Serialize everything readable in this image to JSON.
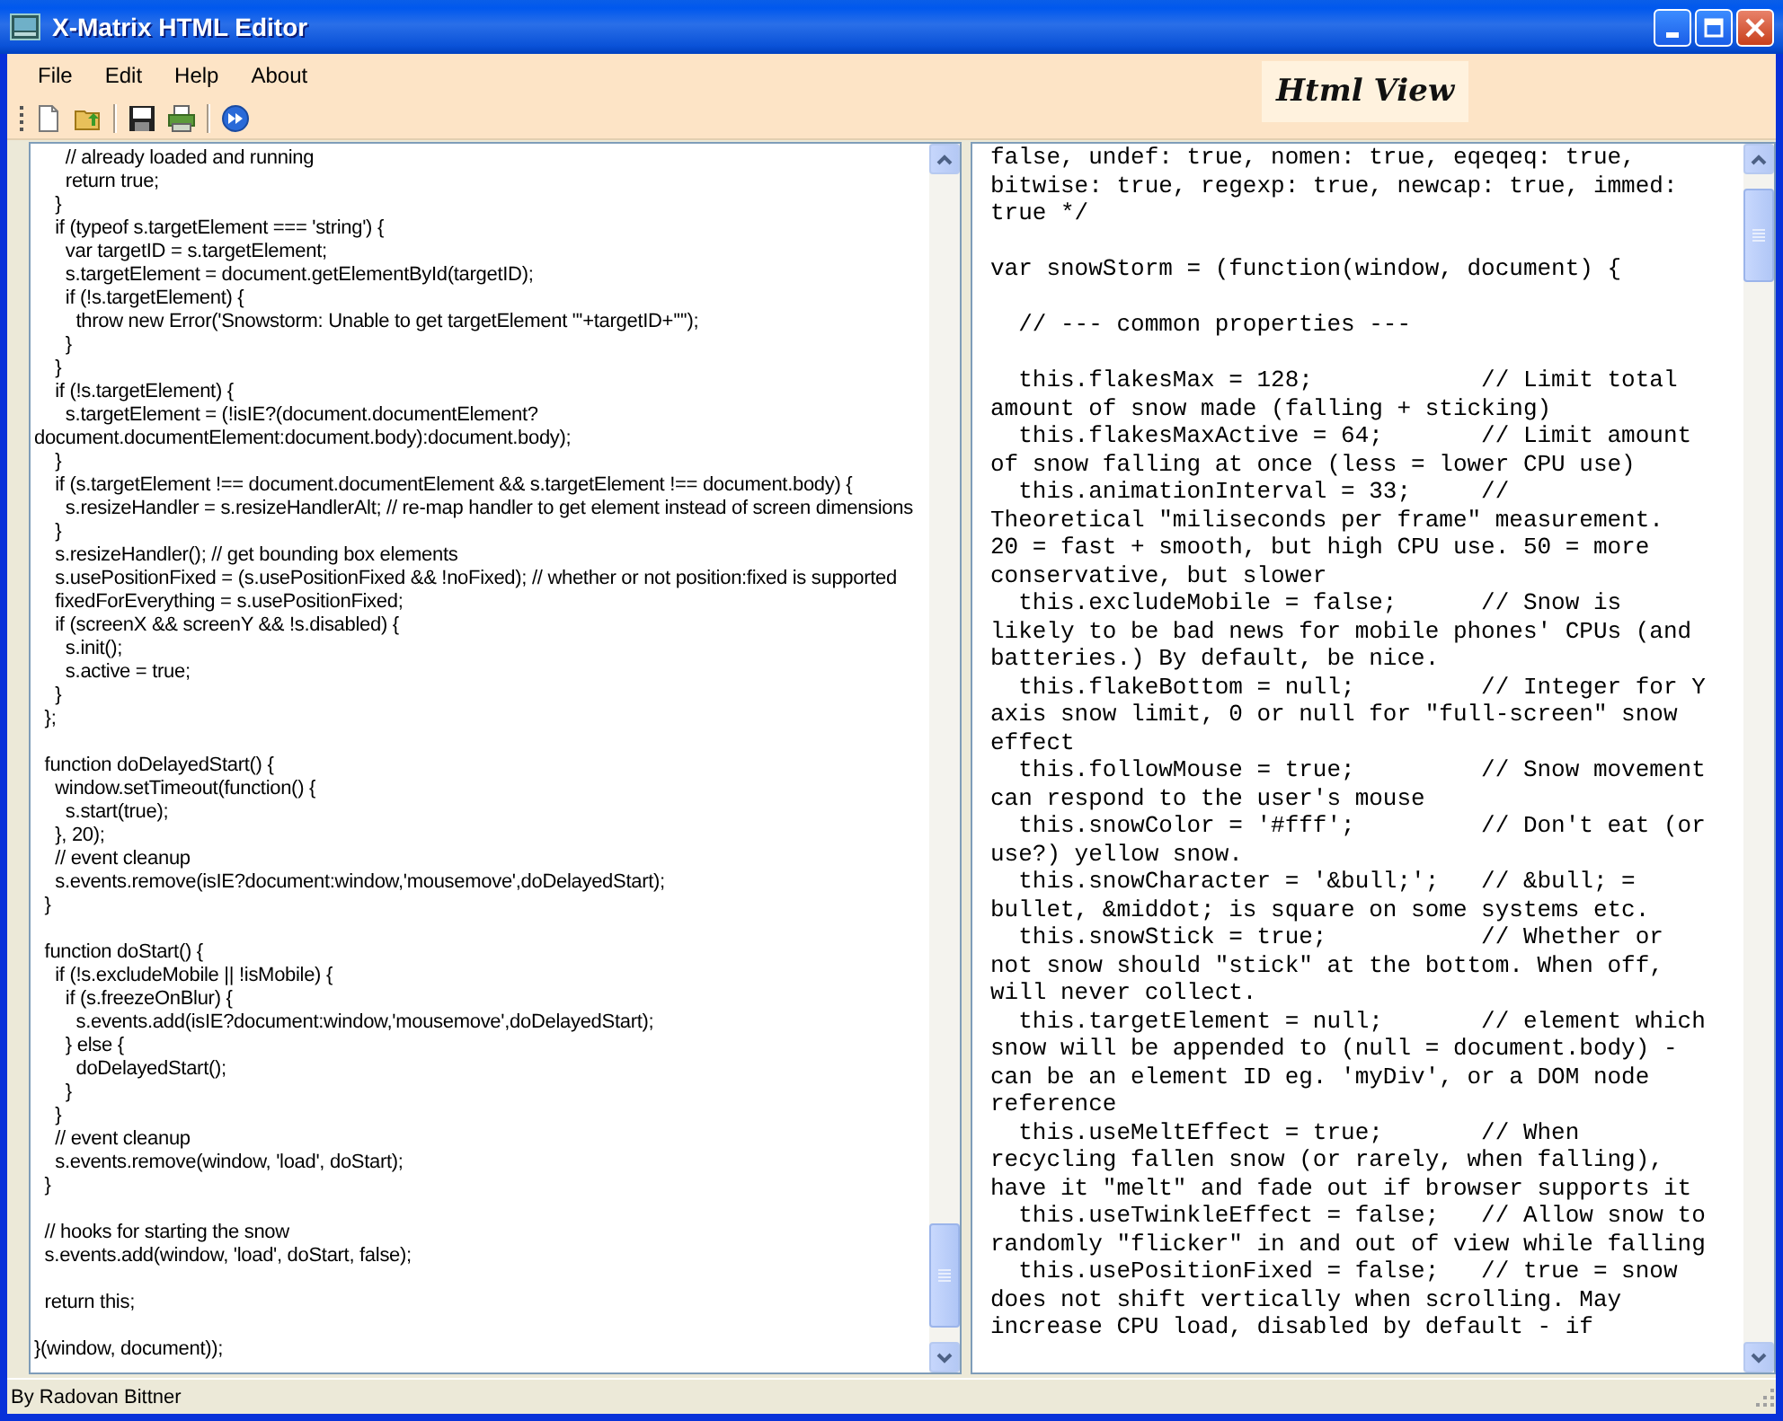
{
  "window": {
    "title": "X-Matrix HTML Editor"
  },
  "menu": [
    "File",
    "Edit",
    "Help",
    "About"
  ],
  "view_label": "Html View",
  "source_pane": {
    "blocks": [
      [
        "      // already loaded and running",
        "      return true;",
        "    }",
        "    if (typeof s.targetElement === 'string') {",
        "      var targetID = s.targetElement;",
        "      s.targetElement = document.getElementById(targetID);",
        "      if (!s.targetElement) {",
        "        throw new Error('Snowstorm: Unable to get targetElement \"'+targetID+'\"');",
        "      }",
        "    }",
        "    if (!s.targetElement) {",
        "      s.targetElement = (!isIE?(document.documentElement?",
        "document.documentElement:document.body):document.body);",
        "    }",
        "    if (s.targetElement !== document.documentElement && s.targetElement !== document.body) {",
        "      s.resizeHandler = s.resizeHandlerAlt; // re-map handler to get element instead of screen dimensions",
        "    }",
        "    s.resizeHandler(); // get bounding box elements",
        "    s.usePositionFixed = (s.usePositionFixed && !noFixed); // whether or not position:fixed is supported",
        "    fixedForEverything = s.usePositionFixed;",
        "    if (screenX && screenY && !s.disabled) {",
        "      s.init();",
        "      s.active = true;",
        "    }",
        "  };"
      ],
      [
        "  function doDelayedStart() {",
        "    window.setTimeout(function() {",
        "      s.start(true);",
        "    }, 20);",
        "    // event cleanup",
        "    s.events.remove(isIE?document:window,'mousemove',doDelayedStart);",
        "  }"
      ],
      [
        "  function doStart() {",
        "    if (!s.excludeMobile || !isMobile) {",
        "      if (s.freezeOnBlur) {",
        "        s.events.add(isIE?document:window,'mousemove',doDelayedStart);",
        "      } else {",
        "        doDelayedStart();",
        "      }",
        "    }",
        "    // event cleanup",
        "    s.events.remove(window, 'load', doStart);",
        "  }"
      ],
      [
        "  // hooks for starting the snow",
        "  s.events.add(window, 'load', doStart, false);"
      ],
      [
        "  return this;"
      ],
      [
        "}(window, document));"
      ]
    ]
  },
  "preview_pane": {
    "blocks": [
      [
        "false, undef: true, nomen: true, eqeqeq: true,",
        "bitwise: true, regexp: true, newcap: true, immed:",
        "true */"
      ],
      [
        "var snowStorm = (function(window, document) {"
      ],
      [
        "  // --- common properties ---"
      ],
      [
        "  this.flakesMax = 128;            // Limit total",
        "amount of snow made (falling + sticking)",
        "  this.flakesMaxActive = 64;       // Limit amount",
        "of snow falling at once (less = lower CPU use)",
        "  this.animationInterval = 33;     //",
        "Theoretical \"miliseconds per frame\" measurement.",
        "20 = fast + smooth, but high CPU use. 50 = more",
        "conservative, but slower",
        "  this.excludeMobile = false;      // Snow is",
        "likely to be bad news for mobile phones' CPUs (and",
        "batteries.) By default, be nice.",
        "  this.flakeBottom = null;         // Integer for Y",
        "axis snow limit, 0 or null for \"full-screen\" snow",
        "effect",
        "  this.followMouse = true;         // Snow movement",
        "can respond to the user's mouse",
        "  this.snowColor = '#fff';         // Don't eat (or",
        "use?) yellow snow.",
        "  this.snowCharacter = '&bull;';   // &bull; =",
        "bullet, &middot; is square on some systems etc.",
        "  this.snowStick = true;           // Whether or",
        "not snow should \"stick\" at the bottom. When off,",
        "will never collect.",
        "  this.targetElement = null;       // element which",
        "snow will be appended to (null = document.body) -",
        "can be an element ID eg. 'myDiv', or a DOM node",
        "reference",
        "  this.useMeltEffect = true;       // When",
        "recycling fallen snow (or rarely, when falling),",
        "have it \"melt\" and fade out if browser supports it",
        "  this.useTwinkleEffect = false;   // Allow snow to",
        "randomly \"flicker\" in and out of view while falling",
        "  this.usePositionFixed = false;   // true = snow",
        "does not shift vertically when scrolling. May",
        "increase CPU load, disabled by default - if"
      ]
    ]
  },
  "status_bar": {
    "text": "By Radovan Bittner"
  }
}
